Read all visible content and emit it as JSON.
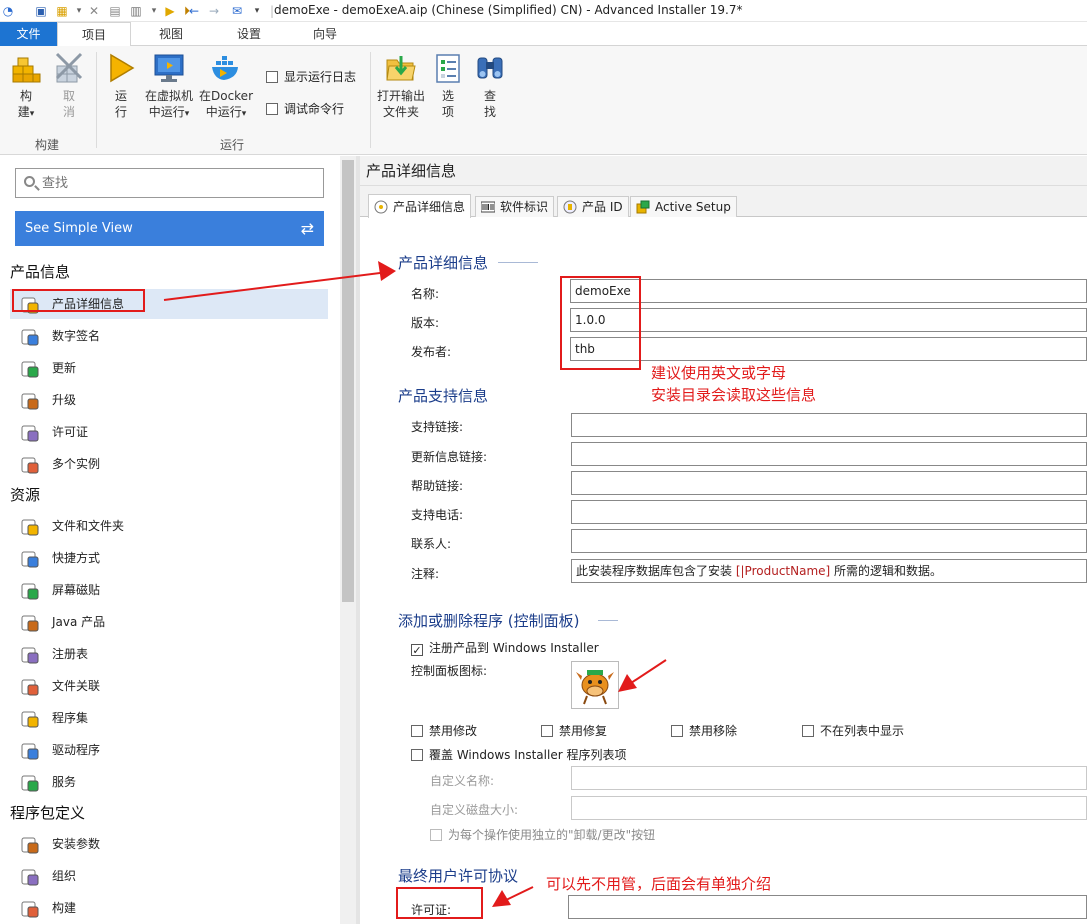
{
  "window": {
    "title": "demoExe - demoExeA.aip (Chinese (Simplified) CN) - Advanced Installer 19.7*"
  },
  "ribbon_tabs": [
    "文件",
    "项目",
    "视图",
    "设置",
    "向导"
  ],
  "ribbon": {
    "build_label_1": "构",
    "build_label_2": "建",
    "build_dropdown": "▾",
    "cancel_label_1": "取",
    "cancel_label_2": "消",
    "build_group": "构建",
    "run_label_1": "运",
    "run_label_2": "行",
    "vm_label_1": "在虚拟机",
    "vm_label_2": "中运行",
    "docker_label_1": "在Docker",
    "docker_label_2": "中运行",
    "show_log_label": "显示运行日志",
    "debug_cmd_label": "调试命令行",
    "run_group": "运行",
    "open_output_1": "打开输出",
    "open_output_2": "文件夹",
    "options_1": "选",
    "options_2": "项",
    "find_1": "查",
    "find_2": "找"
  },
  "left": {
    "search_placeholder": "查找",
    "simple_view_label": "See Simple View",
    "sections": [
      {
        "title": "产品信息",
        "items": [
          "产品详细信息",
          "数字签名",
          "更新",
          "升级",
          "许可证",
          "多个实例"
        ]
      },
      {
        "title": "资源",
        "items": [
          "文件和文件夹",
          "快捷方式",
          "屏幕磁贴",
          "Java 产品",
          "注册表",
          "文件关联",
          "程序集",
          "驱动程序",
          "服务"
        ]
      },
      {
        "title": "程序包定义",
        "items": [
          "安装参数",
          "组织",
          "构建"
        ]
      }
    ]
  },
  "right": {
    "header": "产品详细信息",
    "tabs": [
      "产品详细信息",
      "软件标识",
      "产品 ID",
      "Active Setup"
    ],
    "details_group": "产品详细信息",
    "name_label": "名称:",
    "name_value": "demoExe",
    "version_label": "版本:",
    "version_value": "1.0.0",
    "publisher_label": "发布者:",
    "publisher_value": "thb",
    "support_group": "产品支持信息",
    "support_link_label": "支持链接:",
    "update_link_label": "更新信息链接:",
    "help_link_label": "帮助链接:",
    "support_phone_label": "支持电话:",
    "contact_label": "联系人:",
    "comments_label": "注释:",
    "comments_prefix": "此安装程序数据库包含了安装 ",
    "comments_var": "[|ProductName]",
    "comments_suffix": " 所需的逻辑和数据。",
    "arp_group": "添加或删除程序 (控制面板)",
    "register_label": "注册产品到 Windows Installer",
    "cp_icon_label": "控制面板图标:",
    "disable_modify": "禁用修改",
    "disable_repair": "禁用修复",
    "disable_remove": "禁用移除",
    "hide_in_list": "不在列表中显示",
    "override_label": "覆盖 Windows Installer 程序列表项",
    "custom_name_label": "自定义名称:",
    "custom_size_label": "自定义磁盘大小:",
    "separate_buttons_label": "为每个操作使用独立的\"卸载/更改\"按钮",
    "eula_group": "最终用户许可协议",
    "license_label": "许可证:"
  },
  "annotations": {
    "note1_line1": "建议使用英文或字母",
    "note1_line2": "安装目录会读取这些信息",
    "note2": "可以先不用管，后面会有单独介绍"
  },
  "colors": {
    "accent": "#1d74d2",
    "simple_view_bg": "#3a7fdc",
    "group_title": "#1b3d8a",
    "annotation_red": "#e21b1b",
    "selected_nav": "#dde8f6"
  },
  "icons": {
    "nav": [
      "product-details-icon",
      "signature-icon",
      "updates-icon",
      "upgrade-icon",
      "license-icon",
      "instances-icon",
      "files-folders-icon",
      "shortcuts-icon",
      "tiles-icon",
      "java-icon",
      "registry-icon",
      "file-assoc-icon",
      "assemblies-icon",
      "drivers-icon",
      "services-icon",
      "install-params-icon",
      "organization-icon",
      "build-icon"
    ]
  }
}
